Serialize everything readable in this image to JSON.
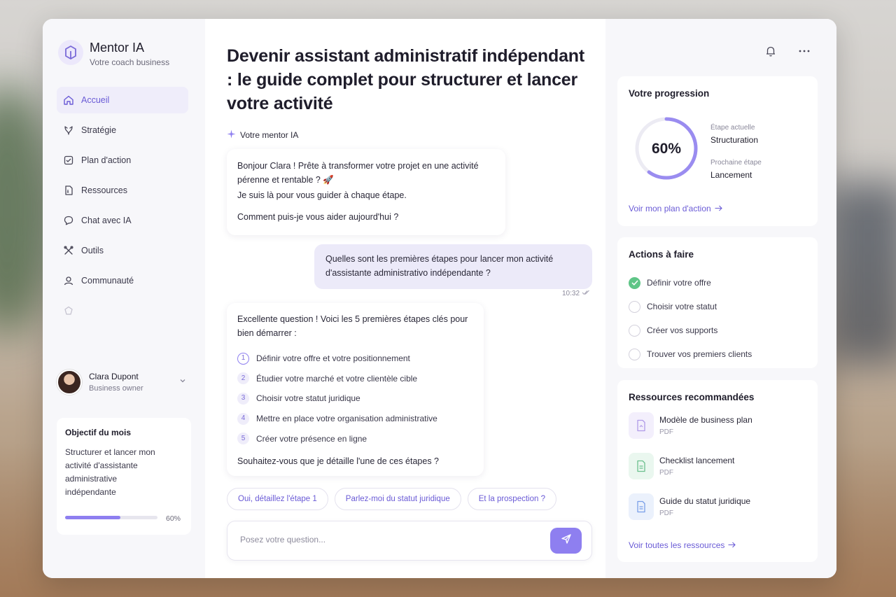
{
  "brand": {
    "title": "Mentor IA",
    "subtitle": "Votre coach business"
  },
  "sidebar": {
    "items": [
      {
        "label": "Accueil",
        "icon": "home-icon"
      },
      {
        "label": "Stratégie",
        "icon": "strategy-icon"
      },
      {
        "label": "Plan d'action",
        "icon": "checklist-icon"
      },
      {
        "label": "Ressources",
        "icon": "document-icon"
      },
      {
        "label": "Chat avec IA",
        "icon": "chat-icon"
      },
      {
        "label": "Outils",
        "icon": "tools-icon"
      },
      {
        "label": "Communauté",
        "icon": "community-icon"
      }
    ],
    "user": {
      "name": "Clara Dupont",
      "role": "Business owner"
    },
    "goal": {
      "title": "Objectif du mois",
      "text": "Structurer et lancer mon activité d'assistante administrative indépendante",
      "progress_label": "60%",
      "progress": 0.6
    }
  },
  "main": {
    "title": "Devenir assistant administratif indépendant : le guide complet pour structurer et lancer votre activité",
    "mentor_label": "Votre mentor IA",
    "messages": {
      "greeting": {
        "line1": "Bonjour Clara ! Prête à transformer votre projet en une activité pérenne et rentable ? 🚀",
        "line2": "Je suis là pour vous guider à chaque étape.",
        "line3": "Comment puis-je vous aider aujourd'hui ?"
      },
      "user_question": "Quelles sont les premières étapes pour lancer mon activité d'assistante administrativo indépendante ?",
      "user_time": "10:32",
      "answer": {
        "intro": "Excellente question ! Voici les 5 premières étapes clés pour bien démarrer :",
        "steps": [
          {
            "num": "1",
            "text": "Définir votre offre et votre positionnement"
          },
          {
            "num": "2",
            "text": "Étudier votre marché et votre clientèle cible"
          },
          {
            "num": "3",
            "text": "Choisir votre statut juridique"
          },
          {
            "num": "4",
            "text": "Mettre en place votre organisation administrative"
          },
          {
            "num": "5",
            "text": "Créer votre présence en ligne"
          }
        ],
        "outro": "Souhaitez-vous que je détaille l'une de ces étapes ?"
      }
    },
    "chips": [
      "Oui, détaillez l'étape 1",
      "Parlez-moi du statut juridique",
      "Et la prospection ?"
    ],
    "input": {
      "placeholder": "Posez votre question...",
      "value": ""
    }
  },
  "right": {
    "progress": {
      "title": "Votre progression",
      "percent_label": "60%",
      "percent": 60,
      "current_label": "Étape actuelle",
      "current_value": "Structuration",
      "next_label": "Prochaine étape",
      "next_value": "Lancement",
      "link": "Voir mon plan d'action"
    },
    "todo": {
      "title": "Actions à faire",
      "items": [
        {
          "text": "Définir votre offre",
          "done": true
        },
        {
          "text": "Choisir votre statut",
          "done": false
        },
        {
          "text": "Créer vos supports",
          "done": false
        },
        {
          "text": "Trouver vos premiers clients",
          "done": false
        }
      ]
    },
    "resources": {
      "title": "Ressources recommandées",
      "items": [
        {
          "title": "Modèle de business plan",
          "type": "PDF",
          "color": "#b09ae8"
        },
        {
          "title": "Checklist lancement",
          "type": "PDF",
          "color": "#6cc08e"
        },
        {
          "title": "Guide du statut juridique",
          "type": "PDF",
          "color": "#7aa0e8"
        }
      ],
      "link": "Voir toutes les ressources"
    }
  },
  "colors": {
    "accent": "#8e7ff0",
    "accent_text": "#6a5bd6",
    "success": "#5fc587"
  }
}
